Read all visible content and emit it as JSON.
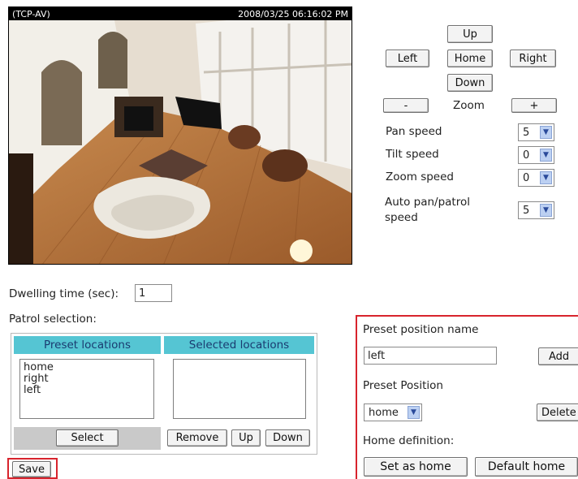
{
  "video": {
    "label": "(TCP-AV)",
    "timestamp": "2008/03/25 06:16:02 PM"
  },
  "ptz": {
    "up": "Up",
    "left": "Left",
    "home": "Home",
    "right": "Right",
    "down": "Down",
    "zoom_out": "-",
    "zoom_label": "Zoom",
    "zoom_in": "+"
  },
  "speeds": [
    {
      "label": "Pan speed",
      "value": "5"
    },
    {
      "label": "Tilt speed",
      "value": "0"
    },
    {
      "label": "Zoom speed",
      "value": "0"
    },
    {
      "label": "Auto pan/patrol speed",
      "value": "5"
    }
  ],
  "patrol": {
    "dwelling_label": "Dwelling time (sec):",
    "dwelling_value": "1",
    "selection_label": "Patrol selection:",
    "preset_header": "Preset locations",
    "selected_header": "Selected locations",
    "preset_items": [
      "home",
      "right",
      "left"
    ],
    "select_button": "Select",
    "remove_button": "Remove",
    "up_button": "Up",
    "down_button": "Down",
    "save_button": "Save"
  },
  "preset": {
    "name_label": "Preset position name",
    "name_value": "left",
    "add_button": "Add",
    "position_label": "Preset Position",
    "position_value": "home",
    "delete_button": "Delete",
    "home_label": "Home definition:",
    "set_home_button": "Set as home",
    "default_home_button": "Default home"
  },
  "colors": {
    "header_teal": "#55c5d3",
    "highlight_red": "#d8242d"
  }
}
